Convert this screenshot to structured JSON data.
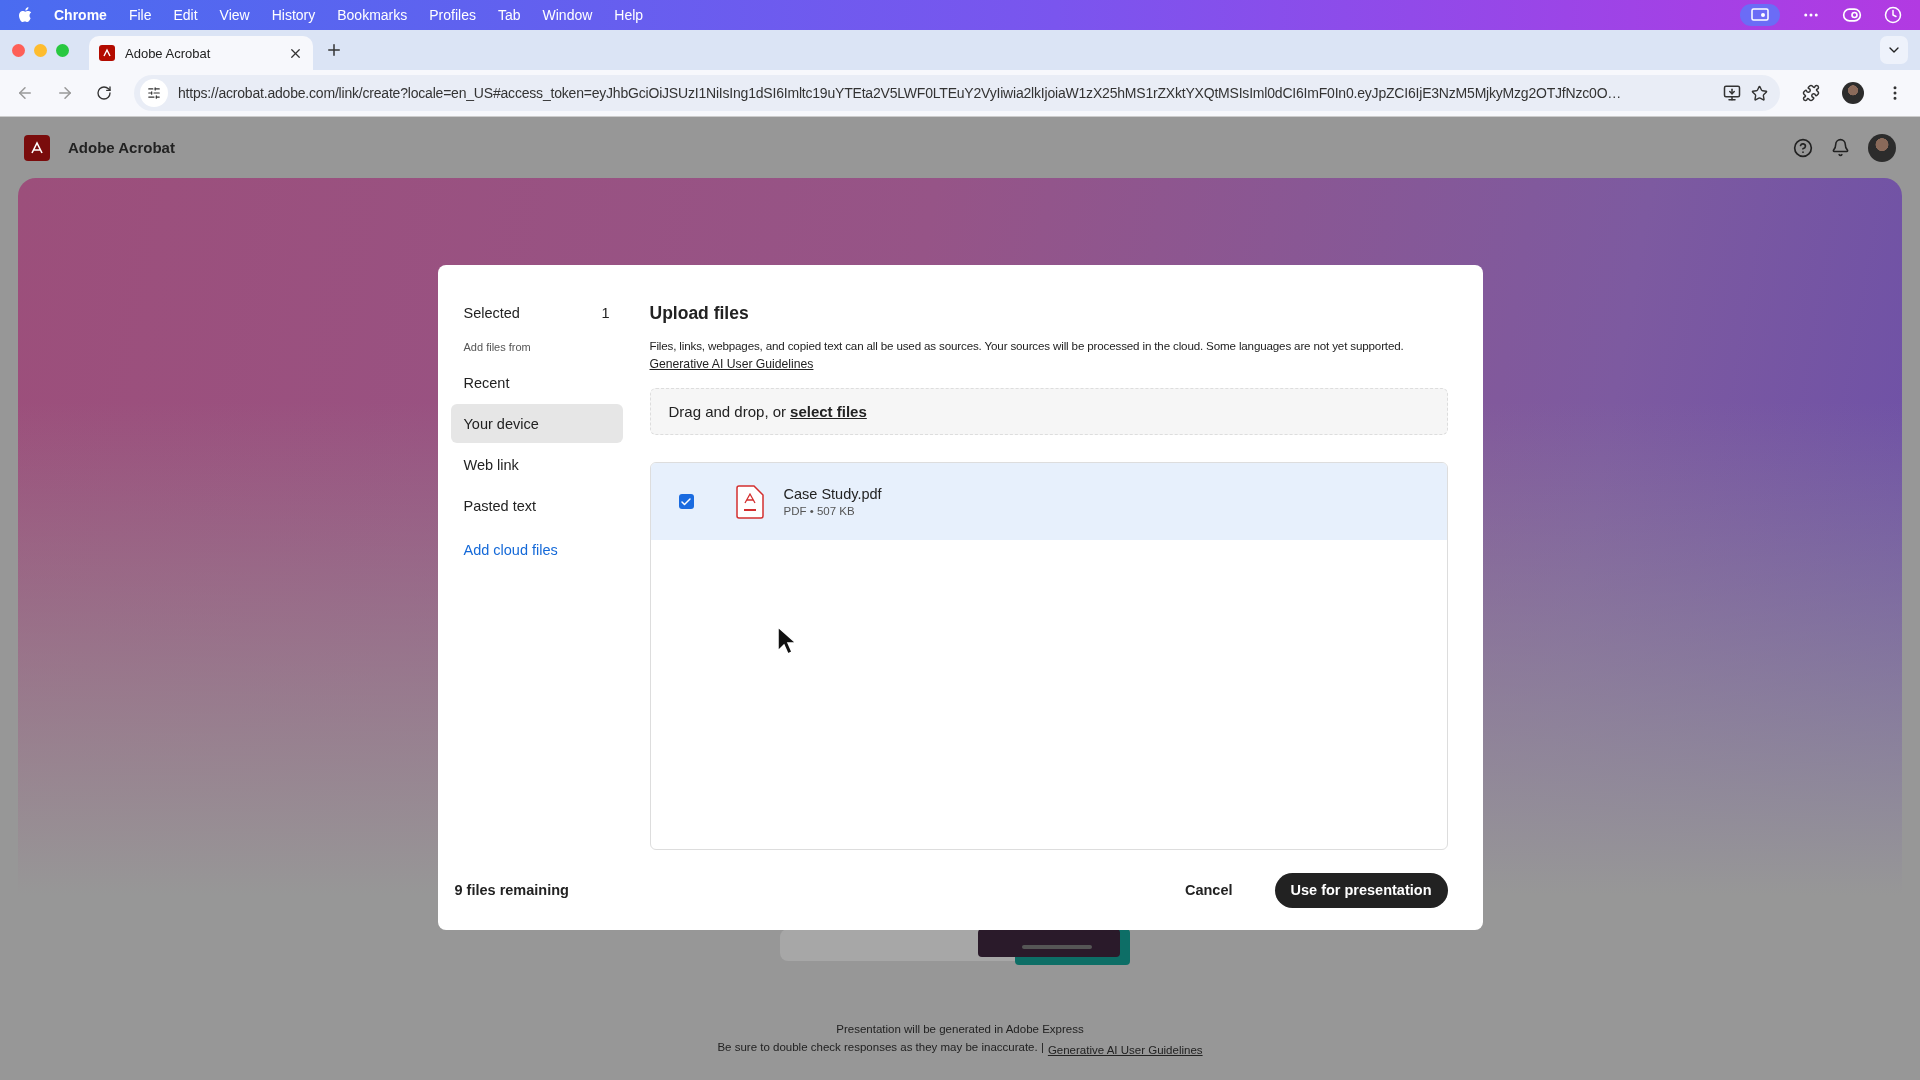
{
  "menu_bar": {
    "app": "Chrome",
    "items": [
      "File",
      "Edit",
      "View",
      "History",
      "Bookmarks",
      "Profiles",
      "Tab",
      "Window",
      "Help"
    ]
  },
  "browser": {
    "tabs": [
      {
        "title": "Adobe Acrobat",
        "selected": true
      }
    ],
    "url": "https://acrobat.adobe.com/link/create?locale=en_US#access_token=eyJhbGciOiJSUzI1NiIsIng1dSI6Imltc19uYTEta2V5LWF0LTEuY2VyIiwia2lkIjoiaW1zX25hMS1rZXktYXQtMSIsIml0dCI6ImF0In0.eyJpZCI6IjE3NzM5MjkyMzg2OTJfNzc0O…"
  },
  "app_header": {
    "title": "Adobe Acrobat"
  },
  "dialog": {
    "sidebar": {
      "selected_label": "Selected",
      "selected_count": "1",
      "section": "Add files from",
      "items": [
        {
          "label": "Recent",
          "selected": false
        },
        {
          "label": "Your device",
          "selected": true
        },
        {
          "label": "Web link",
          "selected": false
        },
        {
          "label": "Pasted text",
          "selected": false
        }
      ],
      "cloud_link": "Add cloud files"
    },
    "title": "Upload files",
    "description": "Files, links, webpages, and copied text can all be used as sources. Your sources will be processed in the cloud. Some languages are not yet supported.",
    "guidelines_link": "Generative AI User Guidelines",
    "dropzone": {
      "text": "Drag and drop, or",
      "link": "select files"
    },
    "files": [
      {
        "name": "Case Study.pdf",
        "meta": "PDF • 507 KB",
        "checked": true,
        "selected": true
      }
    ],
    "remaining": "9 files remaining",
    "cancel": "Cancel",
    "primary": "Use for presentation"
  },
  "footer": {
    "line1": "Presentation will be generated in Adobe Express",
    "line2": "Be sure to double check responses as they may be inaccurate. |",
    "link": "Generative AI User Guidelines"
  }
}
